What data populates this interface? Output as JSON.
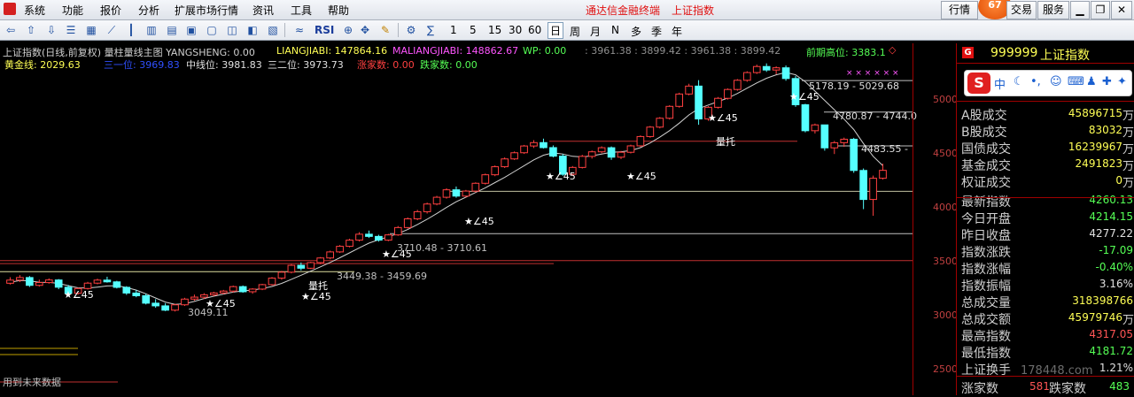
{
  "menu": {
    "items": [
      "系统",
      "功能",
      "报价",
      "分析",
      "扩展市场行情",
      "资讯",
      "工具",
      "帮助"
    ],
    "center_title": "通达信金融终端",
    "center_sub": "上证指数",
    "right_btns": [
      "行情",
      "交易",
      "服务"
    ],
    "badge": "67"
  },
  "toolbar": {
    "periods": [
      "1",
      "5",
      "15",
      "30",
      "60",
      "日",
      "周",
      "月",
      "N",
      "多",
      "季",
      "年"
    ],
    "active_period": "日",
    "rsi_label": "RSI"
  },
  "chart": {
    "title_line": "上证指数(日线,前复权) 量柱量线主图 YANGSHENG: 0.00",
    "liangjiabi": "LIANGJIABI: 147864.16",
    "maliangjiabi": "MALIANGJIABI: 148862.67",
    "wp": "WP: 0.00",
    "levels_line": ": 3961.38 : 3899.42 : 3961.38 : 3899.42",
    "prev_high_label": "前期高位: 3383.1",
    "line2_gold": "黄金线: 2029.63",
    "line2_san1": "三一位: 3969.83",
    "line2_mid": "中线位: 3981.83",
    "line2_san2": "三二位: 3973.73",
    "line2_zhang": "涨家数: 0.00",
    "line2_die": "跌家数: 0.00",
    "annotations": [
      "3049.11",
      "3449.38 - 3459.69",
      "3710.48 - 3710.61",
      "4483.55 -",
      "4780.87 - 4744.0",
      "5178.19 - 5029.68"
    ],
    "star45": "★∠45",
    "liangtuo": "量托",
    "future": "用到未来数据",
    "stars_top": "× × × × × ×"
  },
  "axis": {
    "labels": [
      "5000",
      "4500",
      "4000",
      "3500",
      "3000",
      "2500"
    ]
  },
  "chart_data": {
    "type": "candlestick",
    "ylim": [
      2330,
      5350
    ],
    "ohlc": [
      [
        3291,
        3343,
        3280,
        3318
      ],
      [
        3318,
        3361,
        3301,
        3340
      ],
      [
        3340,
        3353,
        3259,
        3273
      ],
      [
        3273,
        3322,
        3262,
        3297
      ],
      [
        3297,
        3333,
        3287,
        3319
      ],
      [
        3319,
        3327,
        3240,
        3257
      ],
      [
        3257,
        3276,
        3196,
        3205
      ],
      [
        3205,
        3254,
        3193,
        3246
      ],
      [
        3246,
        3303,
        3237,
        3292
      ],
      [
        3292,
        3330,
        3282,
        3318
      ],
      [
        3318,
        3347,
        3296,
        3303
      ],
      [
        3303,
        3312,
        3246,
        3256
      ],
      [
        3256,
        3266,
        3191,
        3207
      ],
      [
        3207,
        3234,
        3171,
        3184
      ],
      [
        3184,
        3201,
        3109,
        3120
      ],
      [
        3120,
        3154,
        3081,
        3097
      ],
      [
        3097,
        3120,
        3052,
        3060
      ],
      [
        3060,
        3114,
        3049,
        3106
      ],
      [
        3106,
        3166,
        3096,
        3155
      ],
      [
        3155,
        3194,
        3141,
        3172
      ],
      [
        3172,
        3206,
        3156,
        3192
      ],
      [
        3192,
        3218,
        3180,
        3208
      ],
      [
        3208,
        3234,
        3197,
        3224
      ],
      [
        3224,
        3271,
        3211,
        3262
      ],
      [
        3262,
        3272,
        3209,
        3218
      ],
      [
        3218,
        3249,
        3201,
        3241
      ],
      [
        3241,
        3286,
        3232,
        3279
      ],
      [
        3279,
        3344,
        3271,
        3335
      ],
      [
        3335,
        3397,
        3321,
        3386
      ],
      [
        3386,
        3455,
        3376,
        3445
      ],
      [
        3445,
        3469,
        3401,
        3420
      ],
      [
        3420,
        3475,
        3412,
        3468
      ],
      [
        3468,
        3516,
        3455,
        3508
      ],
      [
        3508,
        3571,
        3497,
        3560
      ],
      [
        3560,
        3619,
        3551,
        3608
      ],
      [
        3608,
        3673,
        3599,
        3661
      ],
      [
        3661,
        3729,
        3650,
        3712
      ],
      [
        3712,
        3743,
        3680,
        3693
      ],
      [
        3693,
        3707,
        3648,
        3661
      ],
      [
        3661,
        3715,
        3652,
        3706
      ],
      [
        3706,
        3782,
        3698,
        3769
      ],
      [
        3769,
        3856,
        3760,
        3844
      ],
      [
        3844,
        3921,
        3832,
        3905
      ],
      [
        3905,
        3983,
        3889,
        3971
      ],
      [
        3971,
        4041,
        3960,
        4029
      ],
      [
        4029,
        4107,
        4017,
        4093
      ],
      [
        4093,
        4121,
        4025,
        4039
      ],
      [
        4039,
        4092,
        4028,
        4082
      ],
      [
        4082,
        4157,
        4071,
        4149
      ],
      [
        4149,
        4232,
        4138,
        4222
      ],
      [
        4222,
        4302,
        4210,
        4291
      ],
      [
        4291,
        4371,
        4280,
        4358
      ],
      [
        4358,
        4422,
        4349,
        4411
      ],
      [
        4411,
        4478,
        4401,
        4469
      ],
      [
        4469,
        4519,
        4452,
        4498
      ],
      [
        4498,
        4532,
        4447,
        4455
      ],
      [
        4455,
        4474,
        4371,
        4382
      ],
      [
        4382,
        4400,
        4213,
        4226
      ],
      [
        4226,
        4297,
        4212,
        4285
      ],
      [
        4285,
        4393,
        4276,
        4380
      ],
      [
        4380,
        4430,
        4361,
        4419
      ],
      [
        4419,
        4466,
        4407,
        4454
      ],
      [
        4454,
        4465,
        4350,
        4373
      ],
      [
        4373,
        4427,
        4357,
        4415
      ],
      [
        4415,
        4480,
        4405,
        4470
      ],
      [
        4470,
        4560,
        4461,
        4550
      ],
      [
        4550,
        4641,
        4540,
        4631
      ],
      [
        4631,
        4717,
        4620,
        4707
      ],
      [
        4707,
        4819,
        4696,
        4809
      ],
      [
        4809,
        4926,
        4798,
        4915
      ],
      [
        4915,
        5003,
        4904,
        4983
      ],
      [
        4983,
        5034,
        4651,
        4701
      ],
      [
        4701,
        4811,
        4685,
        4801
      ],
      [
        4801,
        4889,
        4790,
        4878
      ],
      [
        4878,
        4963,
        4867,
        4954
      ],
      [
        4954,
        5043,
        4943,
        5033
      ],
      [
        5033,
        5110,
        5020,
        5099
      ],
      [
        5099,
        5167,
        5087,
        5151
      ],
      [
        5151,
        5178,
        5105,
        5121
      ],
      [
        5121,
        5153,
        5085,
        5140
      ],
      [
        5140,
        5160,
        5029,
        5048
      ],
      [
        5048,
        5070,
        4805,
        4823
      ],
      [
        4823,
        4831,
        4586,
        4600
      ],
      [
        4600,
        4661,
        4576,
        4650
      ],
      [
        4650,
        4651,
        4429,
        4453
      ],
      [
        4453,
        4512,
        4400,
        4497
      ],
      [
        4497,
        4541,
        4461,
        4527
      ],
      [
        4527,
        4539,
        4239,
        4259
      ],
      [
        4259,
        4276,
        3927,
        4010
      ],
      [
        4010,
        4215,
        3870,
        4192
      ],
      [
        4192,
        4317,
        4181,
        4260
      ]
    ],
    "ma": [
      3300,
      3315,
      3312,
      3300,
      3298,
      3290,
      3270,
      3252,
      3250,
      3258,
      3268,
      3270,
      3255,
      3232,
      3200,
      3165,
      3130,
      3110,
      3115,
      3135,
      3160,
      3180,
      3198,
      3215,
      3225,
      3233,
      3245,
      3263,
      3290,
      3325,
      3360,
      3395,
      3432,
      3470,
      3510,
      3552,
      3595,
      3635,
      3665,
      3690,
      3718,
      3752,
      3795,
      3840,
      3890,
      3942,
      3990,
      4030,
      4070,
      4110,
      4155,
      4200,
      4250,
      4300,
      4350,
      4390,
      4410,
      4400,
      4380,
      4375,
      4385,
      4400,
      4415,
      4420,
      4430,
      4455,
      4495,
      4545,
      4600,
      4665,
      4735,
      4790,
      4820,
      4850,
      4880,
      4920,
      4965,
      5010,
      5050,
      5080,
      5100,
      5080,
      5020,
      4940,
      4860,
      4780,
      4700,
      4610,
      4490,
      4380,
      4300
    ]
  },
  "panel": {
    "g": "G",
    "code": "999999",
    "name": "上证指数",
    "ime": {
      "s": "S",
      "text": "中"
    },
    "rows": [
      {
        "label": "A股成交",
        "value": "45896715",
        "unit": "万",
        "color": "#ffff55"
      },
      {
        "label": "B股成交",
        "value": "83032",
        "unit": "万",
        "color": "#ffff55"
      },
      {
        "label": "国债成交",
        "value": "16239967",
        "unit": "万",
        "color": "#ffff55"
      },
      {
        "label": "基金成交",
        "value": "2491823",
        "unit": "万",
        "color": "#ffff55"
      },
      {
        "label": "权证成交",
        "value": "0",
        "unit": "万",
        "color": "#ffff55"
      },
      {
        "label": "最新指数",
        "value": "4260.13",
        "unit": "",
        "color": "#55ff55"
      },
      {
        "label": "今日开盘",
        "value": "4214.15",
        "unit": "",
        "color": "#55ff55"
      },
      {
        "label": "昨日收盘",
        "value": "4277.22",
        "unit": "",
        "color": "#e0e0e0"
      },
      {
        "label": "指数涨跌",
        "value": "-17.09",
        "unit": "",
        "color": "#55ff55"
      },
      {
        "label": "指数涨幅",
        "value": "-0.40%",
        "unit": "",
        "color": "#55ff55"
      },
      {
        "label": "指数振幅",
        "value": "3.16%",
        "unit": "",
        "color": "#e0e0e0"
      },
      {
        "label": "总成交量",
        "value": "318398766",
        "unit": "",
        "color": "#ffff55"
      },
      {
        "label": "总成交额",
        "value": "45979746",
        "unit": "万",
        "color": "#ffff55"
      },
      {
        "label": "最高指数",
        "value": "4317.05",
        "unit": "",
        "color": "#ff5555"
      },
      {
        "label": "最低指数",
        "value": "4181.72",
        "unit": "",
        "color": "#55ff55"
      },
      {
        "label": "上证换手",
        "value": "1.21%",
        "unit": "",
        "color": "#e0e0e0"
      }
    ],
    "zhangjia_label": "涨家数",
    "zhangjia_value": "581",
    "diejia_label": "跌家数",
    "diejia_value": "483",
    "watermark": "178448.com"
  }
}
